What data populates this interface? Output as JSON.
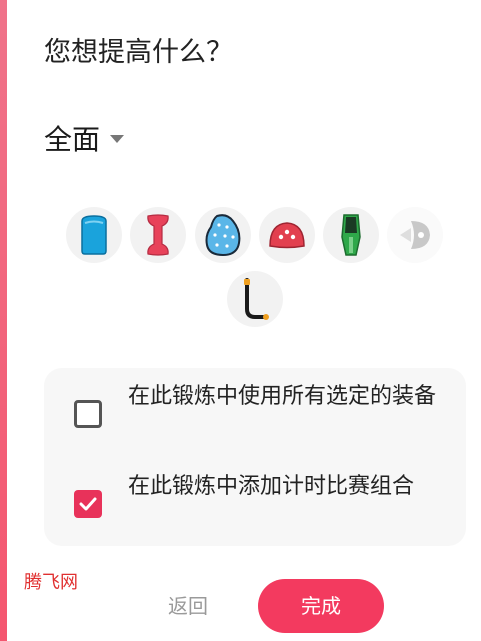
{
  "header": {
    "title": "您想提高什么？"
  },
  "filter": {
    "label": "全面"
  },
  "gear": [
    {
      "icon": "kickboard-icon"
    },
    {
      "icon": "pull-buoy-icon"
    },
    {
      "icon": "hand-paddle-icon"
    },
    {
      "icon": "finger-paddle-icon"
    },
    {
      "icon": "fins-icon"
    },
    {
      "icon": "ankle-float-icon"
    },
    {
      "icon": "snorkel-icon"
    }
  ],
  "options": [
    {
      "label": "在此锻炼中使用所有选定的装备",
      "checked": false
    },
    {
      "label": "在此锻炼中添加计时比赛组合",
      "checked": true
    }
  ],
  "watermark": "腾飞网",
  "footer": {
    "back_label": "返回",
    "done_label": "完成"
  },
  "colors": {
    "accent": "#f33a5f",
    "checkbox_on": "#e8325a",
    "kickboard": "#1aa3dc",
    "fins": "#2fa84a"
  }
}
